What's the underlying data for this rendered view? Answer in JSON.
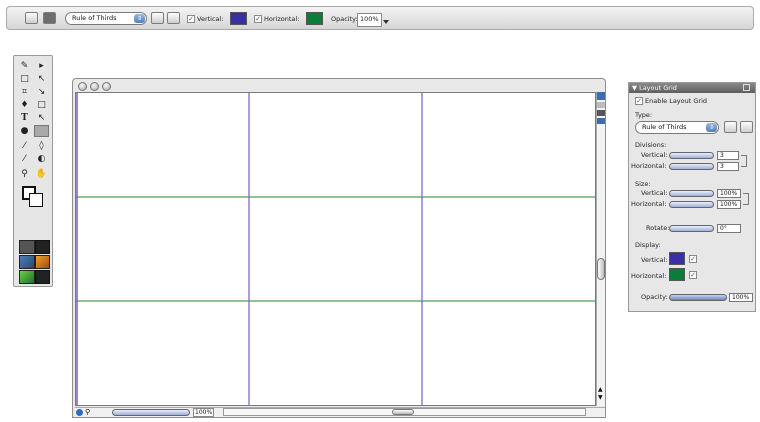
{
  "options_bar": {
    "preset_value": "Rule of Thirds",
    "vertical_label": "Vertical:",
    "vertical_color": "#3a2fa6",
    "horizontal_label": "Horizontal:",
    "horizontal_color": "#0b7d3a",
    "opacity_label": "Opacity:",
    "opacity_value": "100%"
  },
  "document": {
    "grid_vertical_color": "#7b5fb8",
    "grid_horizontal_color": "#4f9a58",
    "zoom_value": "100%"
  },
  "panel": {
    "title": "Layout Grid",
    "enable_label": "Enable Layout Grid",
    "type_label": "Type:",
    "type_value": "Rule of Thirds",
    "divisions_label": "Divisions:",
    "vertical_label": "Vertical:",
    "horizontal_label": "Horizontal:",
    "divisions_vertical_value": "3",
    "divisions_horizontal_value": "3",
    "size_label": "Size:",
    "size_vertical_value": "100%",
    "size_horizontal_value": "100%",
    "rotate_label": "Rotate:",
    "rotate_value": "0°",
    "display_label": "Display:",
    "display_vertical_label": "Vertical:",
    "display_horizontal_label": "Horizontal:",
    "opacity_label": "Opacity:",
    "opacity_value": "100%",
    "display_vertical_color": "#3a2fa6",
    "display_horizontal_color": "#0b7d3a"
  }
}
